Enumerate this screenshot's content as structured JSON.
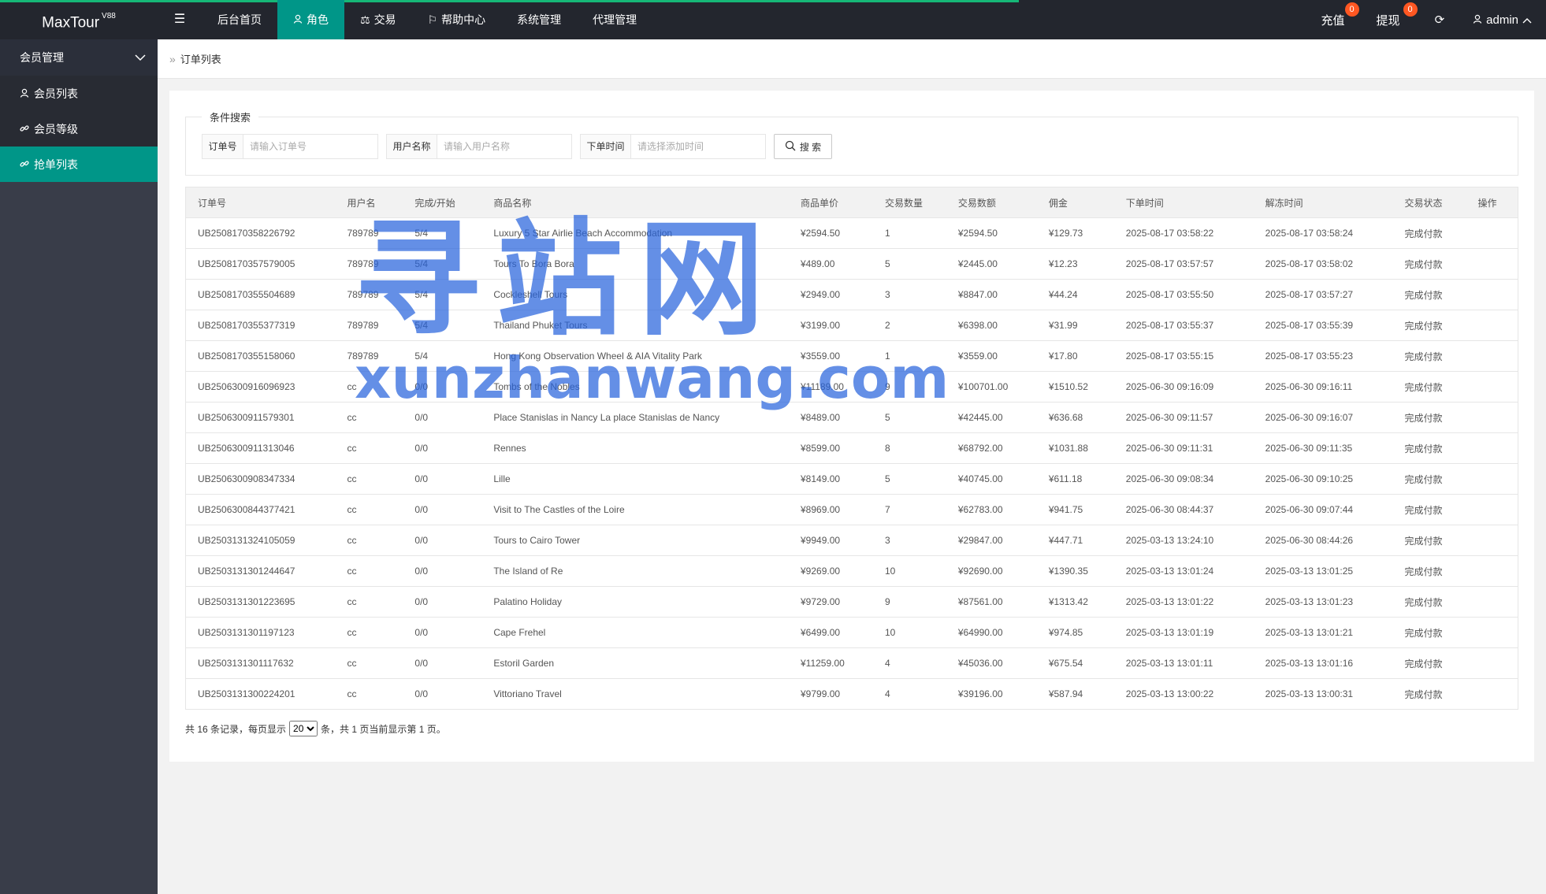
{
  "header": {
    "logo": "MaxTour",
    "logo_sup": "V88",
    "nav": [
      {
        "label": "后台首页",
        "icon": ""
      },
      {
        "label": "角色",
        "icon": "user-icon"
      },
      {
        "label": "交易",
        "icon": "scale-icon"
      },
      {
        "label": "帮助中心",
        "icon": "flag-icon"
      },
      {
        "label": "系统管理",
        "icon": ""
      },
      {
        "label": "代理管理",
        "icon": ""
      }
    ],
    "active_nav": 1,
    "right": {
      "charge_label": "充值",
      "charge_badge": "0",
      "withdraw_label": "提现",
      "withdraw_badge": "0",
      "user_label": "admin"
    }
  },
  "sidebar": {
    "group_label": "会员管理",
    "items": [
      {
        "label": "会员列表",
        "icon": "user-icon"
      },
      {
        "label": "会员等级",
        "icon": "link-icon"
      },
      {
        "label": "抢单列表",
        "icon": "link-icon"
      }
    ],
    "active_item": 2
  },
  "breadcrumb": {
    "current": "订单列表"
  },
  "search": {
    "legend": "条件搜索",
    "order_label": "订单号",
    "order_placeholder": "请输入订单号",
    "user_label": "用户名称",
    "user_placeholder": "请输入用户名称",
    "time_label": "下单时间",
    "time_placeholder": "请选择添加时间",
    "button_label": "搜 索"
  },
  "table": {
    "columns": [
      "订单号",
      "用户名",
      "完成/开始",
      "商品名称",
      "商品单价",
      "交易数量",
      "交易数额",
      "佣金",
      "下单时间",
      "解冻时间",
      "交易状态",
      "操作"
    ],
    "rows": [
      [
        "UB2508170358226792",
        "789789",
        "5/4",
        "Luxury 5 Star Airlie Beach Accommodation",
        "¥2594.50",
        "1",
        "¥2594.50",
        "¥129.73",
        "2025-08-17 03:58:22",
        "2025-08-17 03:58:24",
        "完成付款",
        ""
      ],
      [
        "UB2508170357579005",
        "789789",
        "5/4",
        "Tours To Bora Bora",
        "¥489.00",
        "5",
        "¥2445.00",
        "¥12.23",
        "2025-08-17 03:57:57",
        "2025-08-17 03:58:02",
        "完成付款",
        ""
      ],
      [
        "UB2508170355504689",
        "789789",
        "5/4",
        "Cockleshell Tours",
        "¥2949.00",
        "3",
        "¥8847.00",
        "¥44.24",
        "2025-08-17 03:55:50",
        "2025-08-17 03:57:27",
        "完成付款",
        ""
      ],
      [
        "UB2508170355377319",
        "789789",
        "5/4",
        "Thailand Phuket Tours",
        "¥3199.00",
        "2",
        "¥6398.00",
        "¥31.99",
        "2025-08-17 03:55:37",
        "2025-08-17 03:55:39",
        "完成付款",
        ""
      ],
      [
        "UB2508170355158060",
        "789789",
        "5/4",
        "Hong Kong Observation Wheel & AIA Vitality Park",
        "¥3559.00",
        "1",
        "¥3559.00",
        "¥17.80",
        "2025-08-17 03:55:15",
        "2025-08-17 03:55:23",
        "完成付款",
        ""
      ],
      [
        "UB2506300916096923",
        "cc",
        "0/0",
        "Tombs of the Nobles",
        "¥11189.00",
        "9",
        "¥100701.00",
        "¥1510.52",
        "2025-06-30 09:16:09",
        "2025-06-30 09:16:11",
        "完成付款",
        ""
      ],
      [
        "UB2506300911579301",
        "cc",
        "0/0",
        "Place Stanislas in Nancy La place Stanislas de Nancy",
        "¥8489.00",
        "5",
        "¥42445.00",
        "¥636.68",
        "2025-06-30 09:11:57",
        "2025-06-30 09:16:07",
        "完成付款",
        ""
      ],
      [
        "UB2506300911313046",
        "cc",
        "0/0",
        "Rennes",
        "¥8599.00",
        "8",
        "¥68792.00",
        "¥1031.88",
        "2025-06-30 09:11:31",
        "2025-06-30 09:11:35",
        "完成付款",
        ""
      ],
      [
        "UB2506300908347334",
        "cc",
        "0/0",
        "Lille",
        "¥8149.00",
        "5",
        "¥40745.00",
        "¥611.18",
        "2025-06-30 09:08:34",
        "2025-06-30 09:10:25",
        "完成付款",
        ""
      ],
      [
        "UB2506300844377421",
        "cc",
        "0/0",
        "Visit to The Castles of the Loire",
        "¥8969.00",
        "7",
        "¥62783.00",
        "¥941.75",
        "2025-06-30 08:44:37",
        "2025-06-30 09:07:44",
        "完成付款",
        ""
      ],
      [
        "UB2503131324105059",
        "cc",
        "0/0",
        "Tours to Cairo Tower",
        "¥9949.00",
        "3",
        "¥29847.00",
        "¥447.71",
        "2025-03-13 13:24:10",
        "2025-06-30 08:44:26",
        "完成付款",
        ""
      ],
      [
        "UB2503131301244647",
        "cc",
        "0/0",
        "The Island of Re",
        "¥9269.00",
        "10",
        "¥92690.00",
        "¥1390.35",
        "2025-03-13 13:01:24",
        "2025-03-13 13:01:25",
        "完成付款",
        ""
      ],
      [
        "UB2503131301223695",
        "cc",
        "0/0",
        "Palatino Holiday",
        "¥9729.00",
        "9",
        "¥87561.00",
        "¥1313.42",
        "2025-03-13 13:01:22",
        "2025-03-13 13:01:23",
        "完成付款",
        ""
      ],
      [
        "UB2503131301197123",
        "cc",
        "0/0",
        "Cape Frehel",
        "¥6499.00",
        "10",
        "¥64990.00",
        "¥974.85",
        "2025-03-13 13:01:19",
        "2025-03-13 13:01:21",
        "完成付款",
        ""
      ],
      [
        "UB2503131301117632",
        "cc",
        "0/0",
        "Estoril Garden",
        "¥11259.00",
        "4",
        "¥45036.00",
        "¥675.54",
        "2025-03-13 13:01:11",
        "2025-03-13 13:01:16",
        "完成付款",
        ""
      ],
      [
        "UB2503131300224201",
        "cc",
        "0/0",
        "Vittoriano Travel",
        "¥9799.00",
        "4",
        "¥39196.00",
        "¥587.94",
        "2025-03-13 13:00:22",
        "2025-03-13 13:00:31",
        "完成付款",
        ""
      ]
    ]
  },
  "pager": {
    "prefix": "共 16 条记录，每页显示",
    "page_size": "20",
    "suffix": "条，共 1 页当前显示第 1 页。"
  },
  "watermark": {
    "cn": "寻站网",
    "en": "xunzhanwang.com"
  },
  "colors": {
    "header_bg": "#23262e",
    "sidebar_bg": "#393d49",
    "accent": "#009688",
    "badge": "#ff5722",
    "progress": "#16b777"
  }
}
